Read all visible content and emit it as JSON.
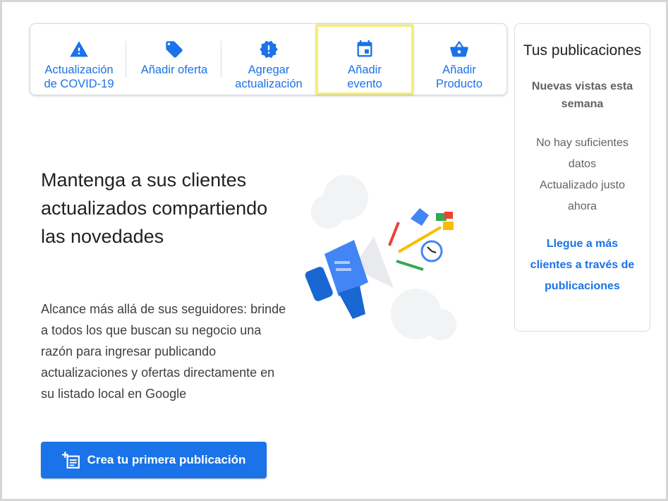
{
  "toolbar": {
    "items": [
      {
        "label": "Actualización\nde COVID-19",
        "icon": "warning-icon"
      },
      {
        "label": "Añadir oferta",
        "icon": "tag-icon"
      },
      {
        "label": "Agregar\nactualización",
        "icon": "alert-badge-icon"
      },
      {
        "label": "Añadir\nevento",
        "icon": "calendar-icon"
      },
      {
        "label": "Añadir\nProducto",
        "icon": "shopping-basket-icon"
      }
    ]
  },
  "main": {
    "headline": "Mantenga a sus clientes actualizados compartiendo las novedades",
    "description": "Alcance más allá de sus seguidores: brinde a todos los que buscan su negocio una razón para ingresar publicando actualizaciones y ofertas directamente en su listado local en Google",
    "cta_label": "Crea tu primera publicación"
  },
  "side": {
    "title": "Tus publicaciones",
    "subtitle": "Nuevas vistas esta semana",
    "no_data": "No hay suficientes datos",
    "updated": "Actualizado justo ahora",
    "link": "Llegue a más clientes a través de publicaciones"
  },
  "colors": {
    "accent": "#1a73e8",
    "highlight": "#f5ef6b"
  }
}
